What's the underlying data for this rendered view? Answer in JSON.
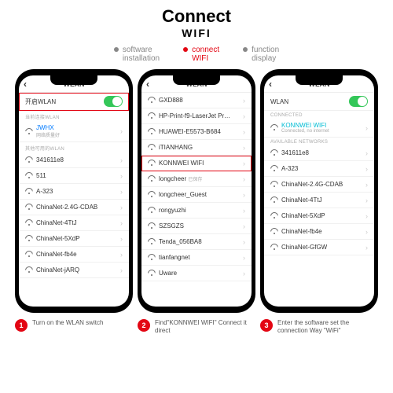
{
  "header": {
    "title": "Connect",
    "subtitle": "WIFI"
  },
  "tabs": [
    {
      "l1": "software",
      "l2": "installation",
      "active": false
    },
    {
      "l1": "connect",
      "l2": "WIFI",
      "active": true
    },
    {
      "l1": "function",
      "l2": "display",
      "active": false
    }
  ],
  "phone1": {
    "title": "WLAN",
    "switch_label": "开启WLAN",
    "section1": "当前连接WLAN",
    "connected": {
      "name": "JWHX",
      "sub": "网络质量好"
    },
    "section2": "其他可用的WLAN",
    "networks": [
      "341611e8",
      "511",
      "A-323",
      "ChinaNet-2.4G-CDAB",
      "ChinaNet-4TtJ",
      "ChinaNet-5XdP",
      "ChinaNet-fb4e",
      "ChinaNet-jARQ"
    ]
  },
  "phone2": {
    "title": "WLAN",
    "networks_top": [
      "GXD888",
      "HP-Print-f9-LaserJet Pro MFP",
      "HUAWEI-E5573-B684",
      "iTIANHANG"
    ],
    "highlight": "KONNWEI WIFI",
    "longcheer": {
      "name": "longcheer",
      "sub": "已保存"
    },
    "networks_bottom": [
      "longcheer_Guest",
      "rongyuzhi",
      "SZSGZS",
      "Tenda_056BA8",
      "tianfangnet",
      "Uware"
    ]
  },
  "phone3": {
    "title": "WLAN",
    "wlan_label": "WLAN",
    "section1": "CONNECTED",
    "connected": {
      "name": "KONNWEI WIFI",
      "sub": "Connected, no internet"
    },
    "section2": "AVAILABLE NETWORKS",
    "networks": [
      "341611e8",
      "A-323",
      "ChinaNet-2.4G-CDAB",
      "ChinaNet-4TtJ",
      "ChinaNet-5XdP",
      "ChinaNet-fb4e",
      "ChinaNet-GfGW"
    ]
  },
  "captions": [
    {
      "num": "1",
      "text": "Turn on the WLAN switch"
    },
    {
      "num": "2",
      "text": "Find\"KONNWEI WIFI\" Connect it direct"
    },
    {
      "num": "3",
      "text": "Enter the software set the connection Way \"WiFi\""
    }
  ]
}
